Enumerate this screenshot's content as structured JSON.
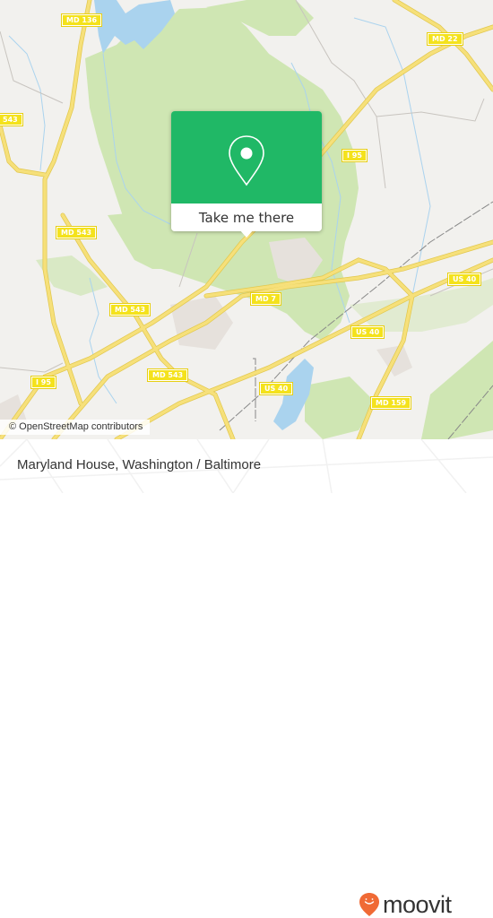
{
  "map": {
    "road_labels": [
      {
        "id": "md136",
        "text": "MD 136"
      },
      {
        "id": "md22",
        "text": "MD 22"
      },
      {
        "id": "md543-left",
        "text": "543"
      },
      {
        "id": "i95-top",
        "text": "I 95"
      },
      {
        "id": "md543-a",
        "text": "MD 543"
      },
      {
        "id": "md543-b",
        "text": "MD 543"
      },
      {
        "id": "md543-c",
        "text": "MD 543"
      },
      {
        "id": "md7",
        "text": "MD 7"
      },
      {
        "id": "us40-a",
        "text": "US 40"
      },
      {
        "id": "us40-b",
        "text": "US 40"
      },
      {
        "id": "us40-c",
        "text": "US 40"
      },
      {
        "id": "i95-bottom",
        "text": "I 95"
      },
      {
        "id": "md159",
        "text": "MD 159"
      }
    ],
    "colors": {
      "land": "#f2f1ee",
      "forest": "#cfe6b3",
      "water": "#aad3ee",
      "road": "#f6e07a",
      "road_edge": "#e2c84e",
      "accent": "#20b866",
      "brand": "#f06a35"
    }
  },
  "popup": {
    "icon": "map-pin-icon",
    "button_label": "Take me there"
  },
  "attribution": "© OpenStreetMap contributors",
  "footer": {
    "title": "Maryland House, Washington / Baltimore",
    "logo_text": "moovit"
  }
}
